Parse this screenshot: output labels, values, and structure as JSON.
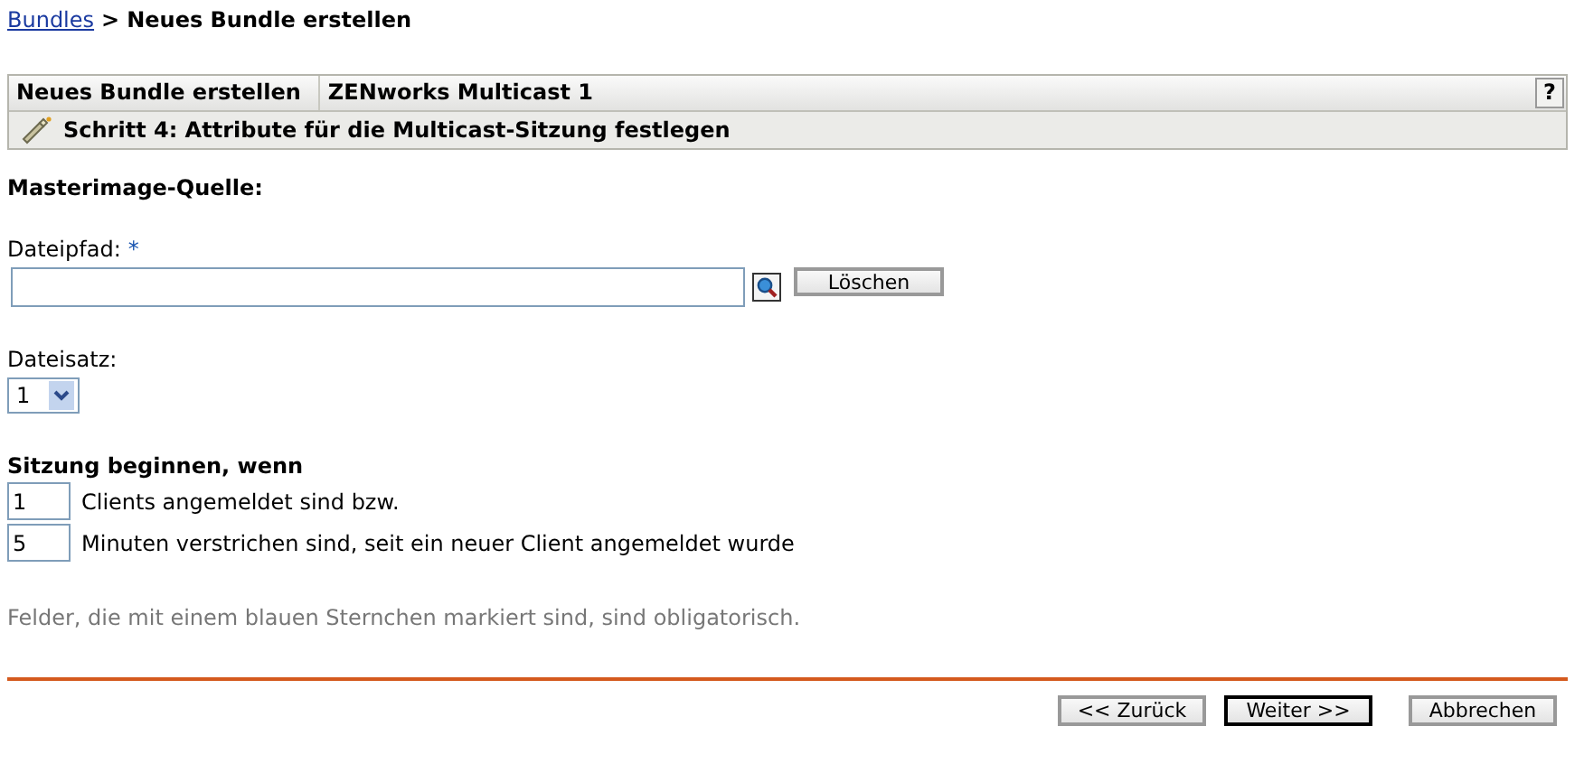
{
  "breadcrumb": {
    "link": "Bundles",
    "separator": ">",
    "current": "Neues Bundle erstellen"
  },
  "header": {
    "tabs": [
      "Neues Bundle erstellen",
      "ZENworks Multicast 1"
    ],
    "help": "?",
    "step": "Schritt 4: Attribute für die Multicast-Sitzung festlegen"
  },
  "section_title": "Masterimage-Quelle:",
  "file_path": {
    "label": "Dateipfad:",
    "required": "*",
    "clear_button": "Löschen"
  },
  "file_set": {
    "label": "Dateisatz:",
    "value": "1"
  },
  "session": {
    "title": "Sitzung beginnen, wenn",
    "conditions": [
      {
        "value": "1",
        "label": "Clients angemeldet sind bzw."
      },
      {
        "value": "5",
        "label": "Minuten verstrichen sind, seit ein neuer Client angemeldet wurde"
      }
    ]
  },
  "note": "Felder, die mit einem blauen Sternchen markiert sind, sind obligatorisch.",
  "buttons": [
    {
      "label": "<< Zurück",
      "default": false
    },
    {
      "label": "Weiter >>",
      "default": true
    },
    {
      "label": "Abbrechen",
      "default": false
    }
  ]
}
